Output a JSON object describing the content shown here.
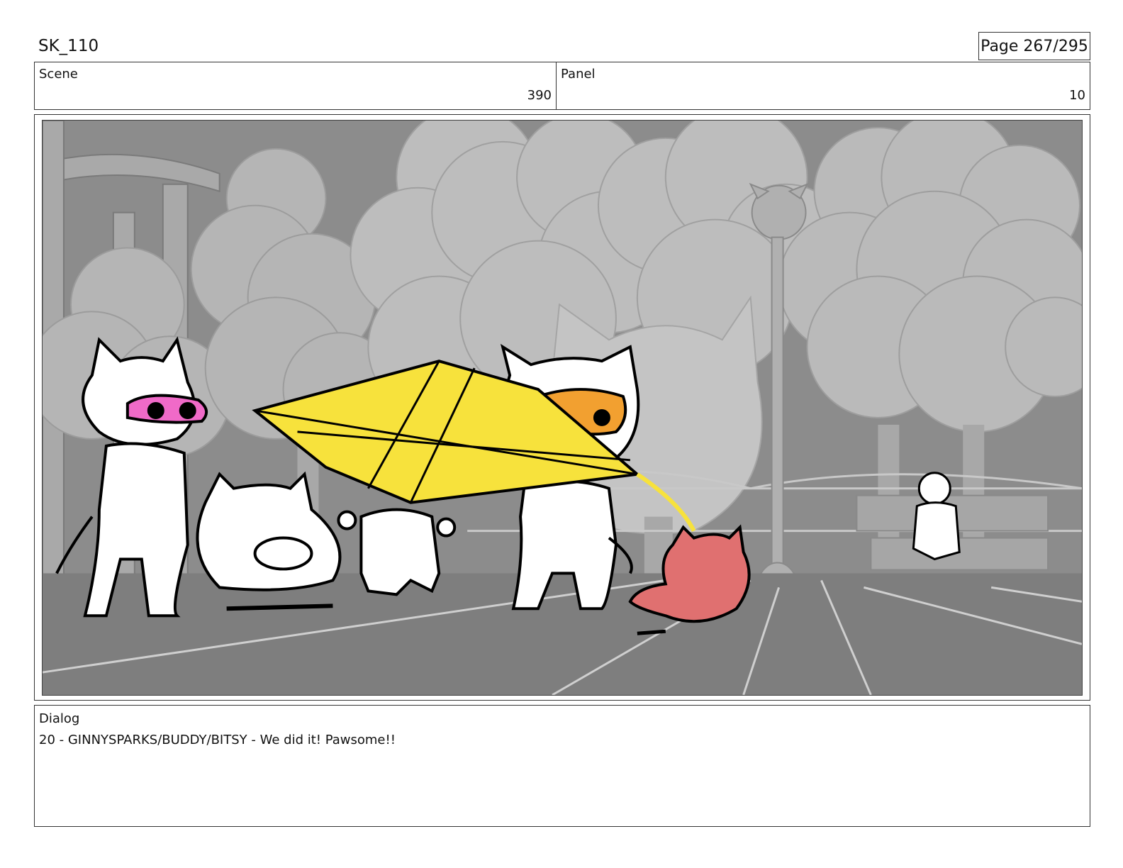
{
  "header": {
    "project": "SK_110",
    "page": "Page 267/295"
  },
  "scene": {
    "label": "Scene",
    "value": "390"
  },
  "panel": {
    "label": "Panel",
    "value": "10"
  },
  "dialog": {
    "label": "Dialog",
    "text": "20 - GINNYSPARKS/BUDDY/BITSY - We did it! Pawsome!!"
  },
  "colors": {
    "background_gray": "#8a8a8a",
    "tree_gray": "#b8b8b8",
    "ground_gray": "#7e7e7e",
    "kite_yellow": "#f7e23c",
    "mask_pink": "#f06ac8",
    "mask_orange": "#f2a030",
    "red_cat": "#e07070"
  }
}
